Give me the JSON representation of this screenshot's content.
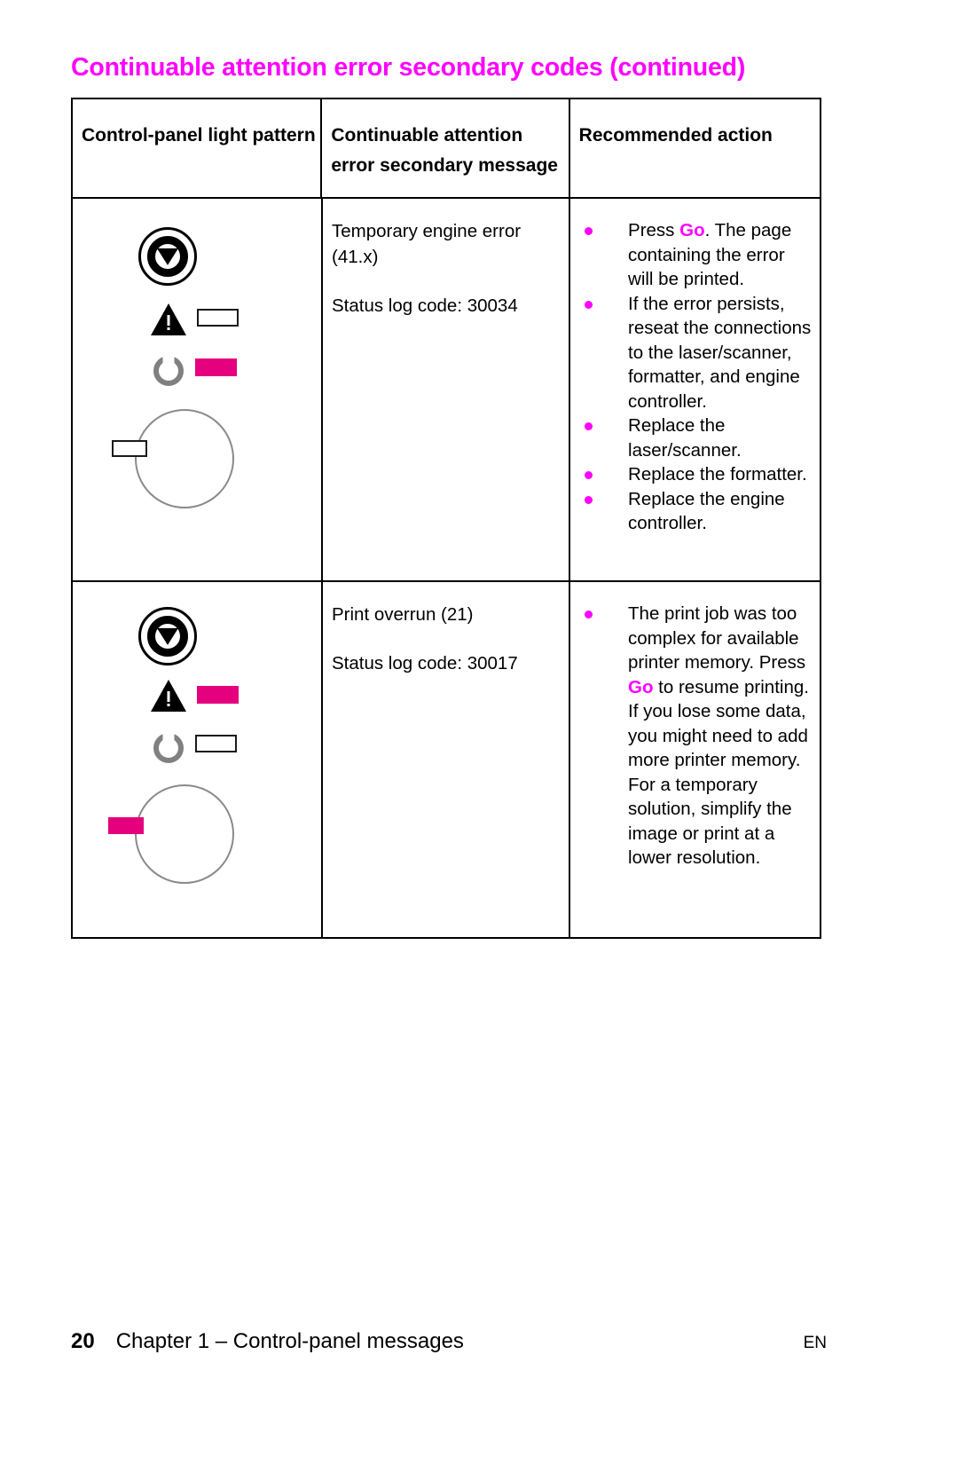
{
  "document": {
    "title": "Continuable attention error secondary codes (continued)",
    "accent_color": "#ff00ff",
    "light_on_color": "#e5007d"
  },
  "table": {
    "headers": {
      "col1": "Control-panel light pattern",
      "col2": "Continuable attention error secondary message",
      "col3": "Recommended action"
    },
    "rows": [
      {
        "panel": {
          "go_button": "go-button-icon",
          "attention_light": "off",
          "ready_light": "on",
          "data_light": "off"
        },
        "message_lines": [
          "Temporary engine error (41.x)",
          "Status log code: 30034"
        ],
        "actions": [
          {
            "pre": "Press ",
            "highlight": "Go",
            "post": ". The page containing the error will be printed."
          },
          {
            "pre": "If the error persists, reseat the connections to the laser/scanner, formatter, and engine controller.",
            "highlight": "",
            "post": ""
          },
          {
            "pre": "Replace the laser/scanner.",
            "highlight": "",
            "post": ""
          },
          {
            "pre": "Replace the formatter.",
            "highlight": "",
            "post": ""
          },
          {
            "pre": "Replace the engine controller.",
            "highlight": "",
            "post": ""
          }
        ]
      },
      {
        "panel": {
          "go_button": "go-button-icon",
          "attention_light": "on",
          "ready_light": "off",
          "data_light": "on"
        },
        "message_lines": [
          "Print overrun (21)",
          "Status log code: 30017"
        ],
        "actions": [
          {
            "pre": "The print job was too complex for available printer memory. Press ",
            "highlight": "Go",
            "post": " to resume printing. If you lose some data, you might need to add more printer memory. For a temporary solution, simplify the image or print at a lower resolution."
          }
        ]
      }
    ]
  },
  "footer": {
    "page_number": "20",
    "chapter": "Chapter 1 –  Control-panel messages",
    "language": "EN"
  }
}
